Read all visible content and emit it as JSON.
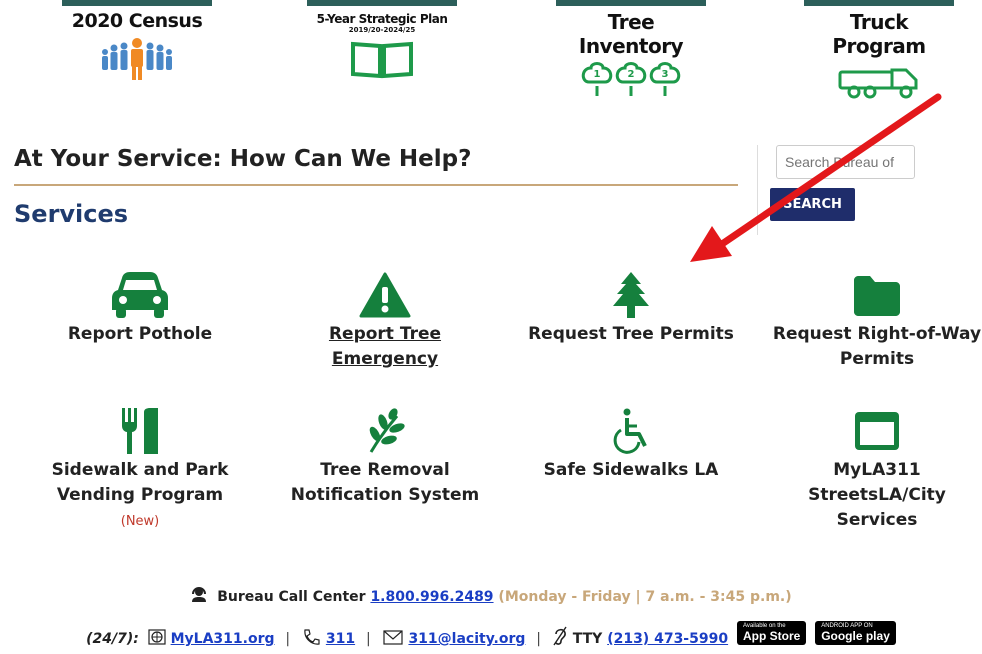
{
  "banner": {
    "census": {
      "title": "2020 Census",
      "icon": "people-crowd-icon"
    },
    "plan": {
      "title": "5-Year Strategic Plan",
      "subtitle": "2019/20-2024/25",
      "icon": "open-book-icon"
    },
    "tree": {
      "title": "Tree Inventory",
      "icon": "numbered-trees-icon"
    },
    "truck": {
      "title": "Truck Program",
      "icon": "truck-icon"
    }
  },
  "main": {
    "heading": "At Your Service: How Can We Help?",
    "services_heading": "Services"
  },
  "search": {
    "placeholder": "Search Bureau of",
    "button_label": "SEARCH"
  },
  "services": [
    {
      "label": "Report Pothole",
      "icon": "car-icon"
    },
    {
      "label": "Report Tree Emergency",
      "icon": "warning-icon"
    },
    {
      "label": "Request Tree Permits",
      "icon": "pine-tree-icon"
    },
    {
      "label": "Request Right-of-Way Permits",
      "icon": "folder-icon"
    },
    {
      "label": "Sidewalk and Park Vending Program",
      "note": "(New)",
      "icon": "utensils-icon"
    },
    {
      "label": "Tree Removal Notification System",
      "icon": "leaf-sprig-icon"
    },
    {
      "label": "Safe Sidewalks LA",
      "icon": "wheelchair-icon"
    },
    {
      "label": "MyLA311 StreetsLA/City Services",
      "icon": "window-icon"
    }
  ],
  "footer": {
    "call_center_label": "Bureau Call Center",
    "call_center_phone": "1.800.996.2489",
    "call_center_hours": "(Monday - Friday | 7 a.m. - 3:45 p.m.)",
    "availability": "(24/7):",
    "website": "MyLA311.org",
    "phone_311": "311",
    "email": "311@lacity.org",
    "tty_label": "TTY",
    "tty_phone": "(213) 473-5990",
    "app_store_small": "Available on the",
    "app_store_big": "App Store",
    "google_play_small": "ANDROID APP ON",
    "google_play_big": "Google play"
  },
  "colors": {
    "service_green": "#15803d",
    "heading_navy": "#1f3b6e",
    "banner_bar": "#2c5f5a",
    "link_blue": "#1a3ec4",
    "gold_rule": "#c8a77a",
    "arrow_red": "#e3181b"
  }
}
